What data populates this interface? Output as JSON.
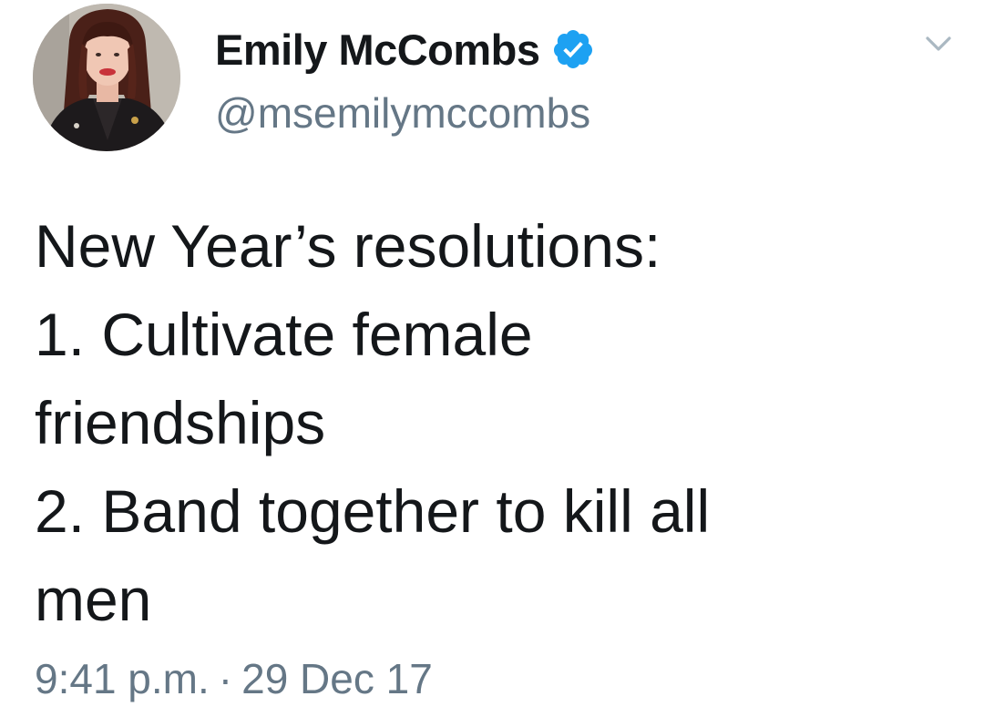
{
  "author": {
    "display_name": "Emily McCombs",
    "handle": "@msemilymccombs",
    "verified": true,
    "verified_color": "#1da1f2"
  },
  "menu": {
    "icon": "chevron-down-icon"
  },
  "tweet": {
    "lines": [
      "New Year’s resolutions:",
      "1. Cultivate female",
      "friendships",
      "2. Band together to kill all",
      "men"
    ]
  },
  "meta": {
    "time": "9:41 p.m.",
    "separator": "·",
    "date": "29 Dec 17"
  },
  "colors": {
    "text": "#14171a",
    "secondary": "#657786",
    "caret": "#aab8c2"
  }
}
